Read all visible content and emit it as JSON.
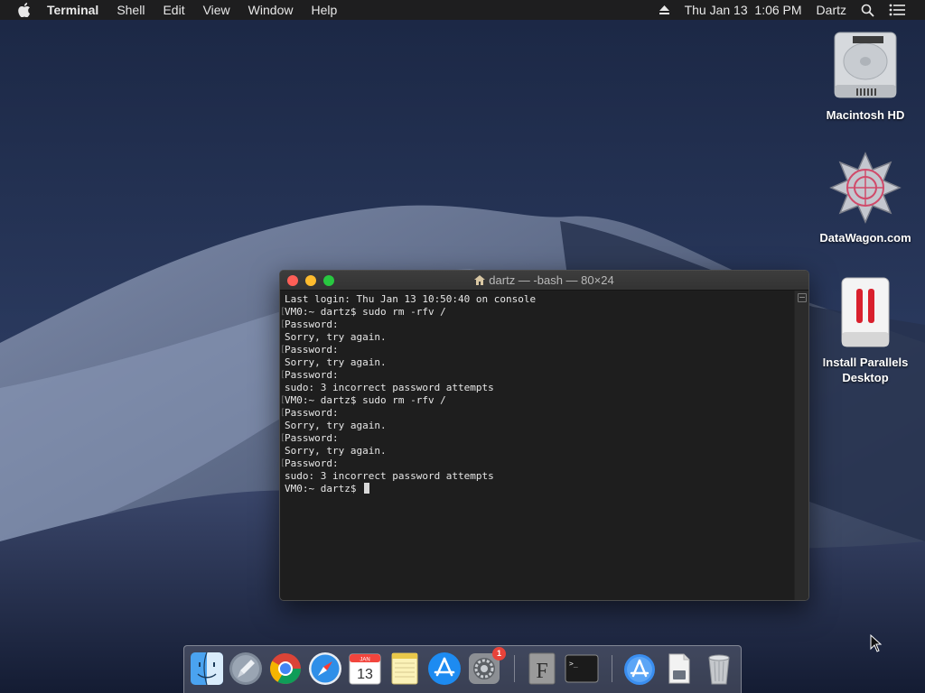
{
  "menubar": {
    "app_name": "Terminal",
    "menus": [
      "Shell",
      "Edit",
      "View",
      "Window",
      "Help"
    ],
    "datetime": "Thu Jan 13  1:06 PM",
    "user": "Dartz"
  },
  "desktop_icons": [
    {
      "label": "Macintosh HD",
      "icon": "hard-drive-icon"
    },
    {
      "label": "DataWagon.com",
      "icon": "datawagon-icon"
    },
    {
      "label": "Install Parallels Desktop",
      "icon": "parallels-icon"
    }
  ],
  "terminal": {
    "title": "dartz — -bash — 80×24",
    "lines": [
      "Last login: Thu Jan 13 10:50:40 on console",
      "VM0:~ dartz$ sudo rm -rfv /",
      "Password:",
      "Sorry, try again.",
      "Password:",
      "Sorry, try again.",
      "Password:",
      "sudo: 3 incorrect password attempts",
      "VM0:~ dartz$ sudo rm -rfv /",
      "Password:",
      "Sorry, try again.",
      "Password:",
      "Sorry, try again.",
      "Password:",
      "sudo: 3 incorrect password attempts",
      "VM0:~ dartz$ "
    ]
  },
  "dock": {
    "calendar_month": "JAN",
    "calendar_day": "13",
    "system_prefs_badge": "1",
    "font_book_letter": "F",
    "terminal_prompt": ">_"
  },
  "colors": {
    "menubar_bg": "#1e1e1f",
    "terminal_bg": "#1e1e1e",
    "close": "#ff5f57",
    "minimize": "#febc2e",
    "maximize": "#28c840"
  }
}
